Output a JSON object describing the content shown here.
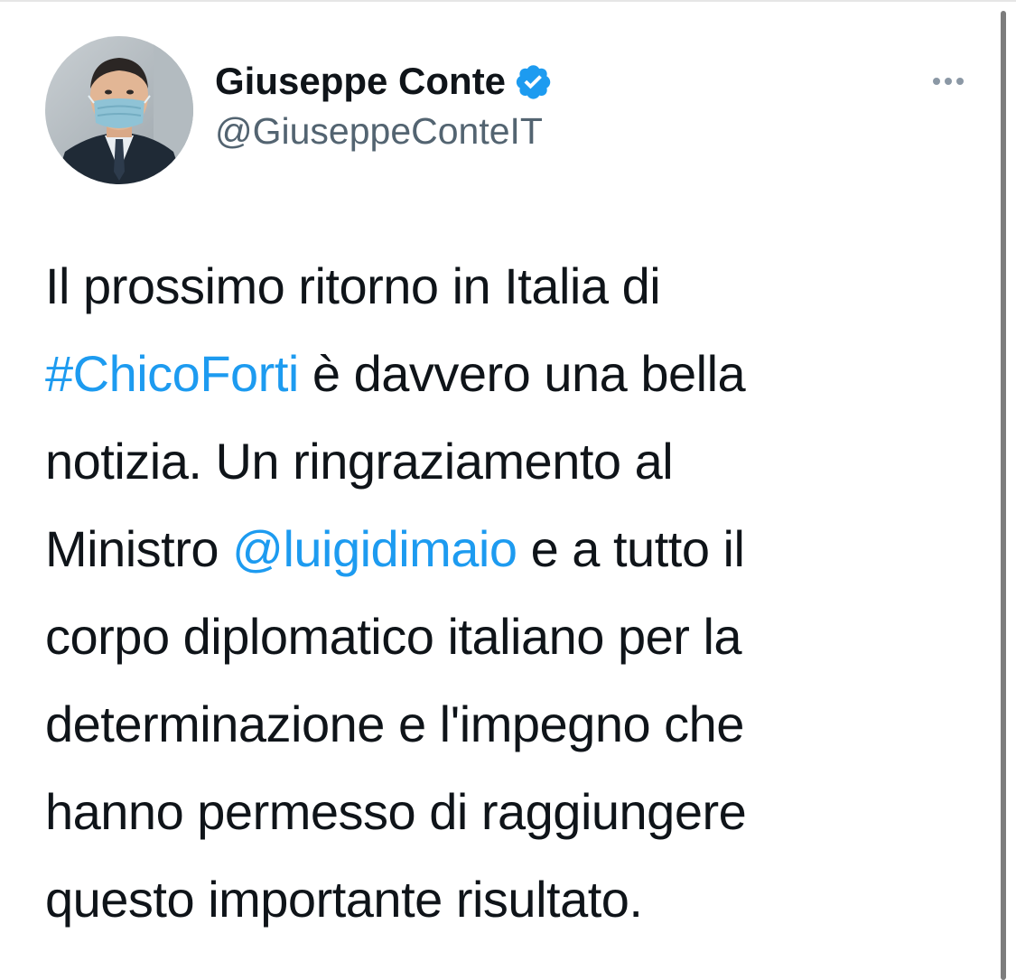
{
  "tweet": {
    "author": {
      "display_name": "Giuseppe Conte",
      "handle": "@GiuseppeConteIT",
      "verified_icon": "verified-badge-icon",
      "avatar_icon": "profile-photo"
    },
    "more_icon": "more-options-icon",
    "text_lines": [
      [
        {
          "text": "Il prossimo ritorno in Italia di"
        }
      ],
      [
        {
          "text": "#ChicoForti",
          "link": true
        },
        {
          "text": " è davvero una bella"
        }
      ],
      [
        {
          "text": "notizia. Un ringraziamento al"
        }
      ],
      [
        {
          "text": "Ministro "
        },
        {
          "text": "@luigidimaio",
          "link": true
        },
        {
          "text": " e a tutto il"
        }
      ],
      [
        {
          "text": "corpo diplomatico italiano per la"
        }
      ],
      [
        {
          "text": "determinazione e l'impegno che"
        }
      ],
      [
        {
          "text": "hanno permesso di raggiungere"
        }
      ],
      [
        {
          "text": "questo importante risultato."
        }
      ]
    ]
  },
  "colors": {
    "link": "#1d9bf0",
    "verified": "#1d9bf0",
    "text": "#0f1419",
    "secondary": "#536471"
  }
}
